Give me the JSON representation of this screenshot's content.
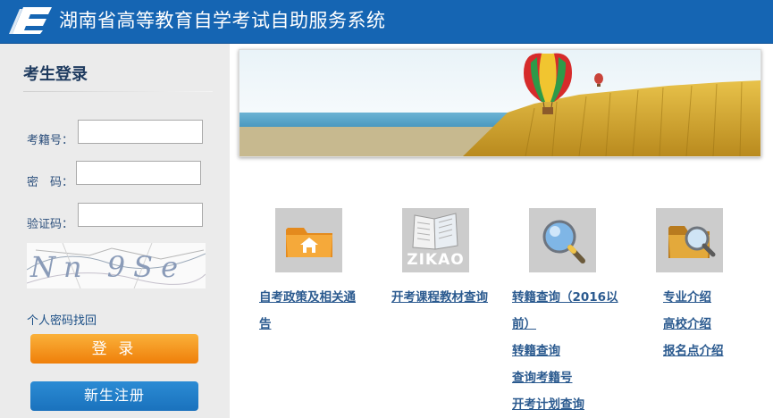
{
  "header": {
    "title": "湖南省高等教育自学考试自助服务系统"
  },
  "login": {
    "title": "考生登录",
    "labels": {
      "exam_no": "考籍号：",
      "password": "密　码：",
      "captcha": "验证码："
    },
    "values": {
      "exam_no": "",
      "password": "",
      "captcha": ""
    },
    "captcha_text": "Nn 9Se",
    "forgot_link": "个人密码找回",
    "login_button": "登 录",
    "register_button": "新生注册"
  },
  "menu": {
    "tiles": [
      {
        "icon": "folder-home-icon"
      },
      {
        "icon": "zikao-book-icon",
        "text": "ZIKAO"
      },
      {
        "icon": "magnifier-icon"
      },
      {
        "icon": "folder-search-icon"
      }
    ],
    "col1": [
      "自考政策及相关通",
      "告"
    ],
    "col2": [
      "开考课程教材查询"
    ],
    "col3": [
      "转籍查询（2016以",
      "前）",
      "转籍查询",
      "查询考籍号",
      "开考计划查询"
    ],
    "col4": [
      "专业介绍",
      "高校介绍",
      "报名点介绍"
    ]
  },
  "colors": {
    "header_bg": "#1565b3",
    "sidebar_bg": "#ebebeb",
    "login_button": "#f39316",
    "register_button": "#1a72bd",
    "link": "#2b5a8f"
  }
}
